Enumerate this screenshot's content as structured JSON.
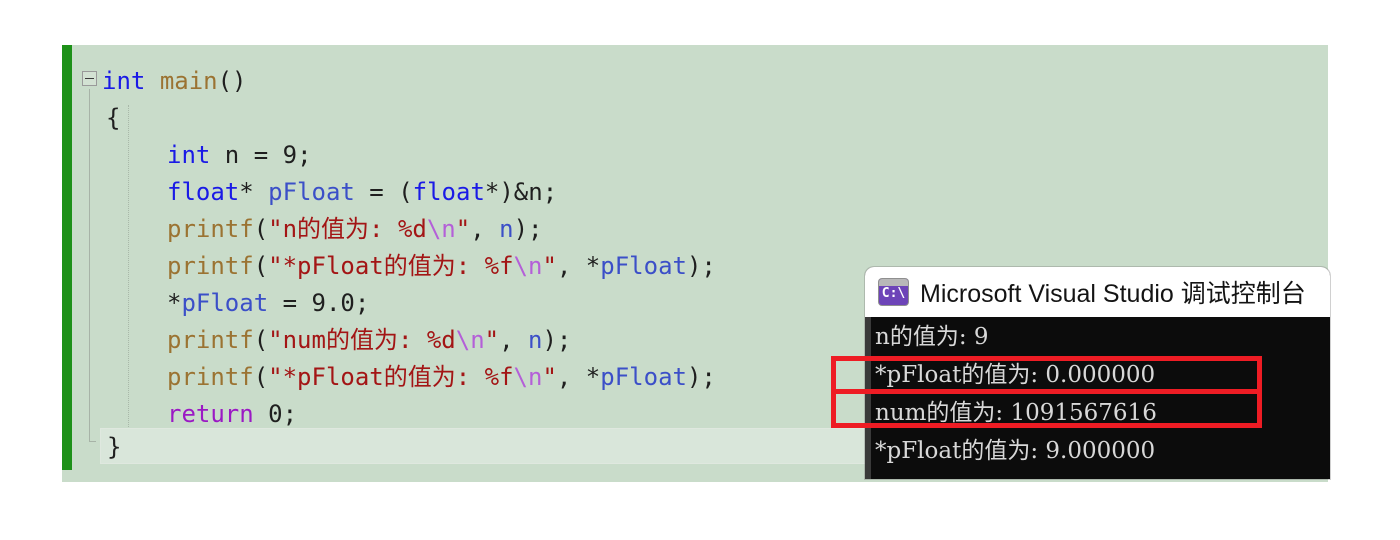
{
  "editor": {
    "name": "visual-studio-code-editor",
    "background_color": "#c9dcca",
    "change_bar_color": "#1e9119",
    "collapse_glyph": "−",
    "code_lines": [
      {
        "indent": 0,
        "tokens": [
          {
            "cls": "kw",
            "t": "int"
          },
          {
            "cls": "plain",
            "t": " "
          },
          {
            "cls": "fn",
            "t": "main"
          },
          {
            "cls": "plain",
            "t": "()"
          }
        ]
      },
      {
        "indent": 1,
        "tokens": [
          {
            "cls": "plain",
            "t": "{"
          }
        ]
      },
      {
        "indent": 2,
        "tokens": [
          {
            "cls": "kw",
            "t": "int"
          },
          {
            "cls": "plain",
            "t": " n = "
          },
          {
            "cls": "num",
            "t": "9"
          },
          {
            "cls": "plain",
            "t": ";"
          }
        ]
      },
      {
        "indent": 2,
        "tokens": [
          {
            "cls": "kw",
            "t": "float"
          },
          {
            "cls": "plain",
            "t": "* "
          },
          {
            "cls": "var",
            "t": "pFloat"
          },
          {
            "cls": "plain",
            "t": " = ("
          },
          {
            "cls": "kw",
            "t": "float"
          },
          {
            "cls": "plain",
            "t": "*)&n;"
          }
        ]
      },
      {
        "indent": 2,
        "tokens": [
          {
            "cls": "fn",
            "t": "printf"
          },
          {
            "cls": "plain",
            "t": "("
          },
          {
            "cls": "str",
            "t": "\"n的值为: %d"
          },
          {
            "cls": "esc",
            "t": "\\n"
          },
          {
            "cls": "str",
            "t": "\""
          },
          {
            "cls": "plain",
            "t": ", "
          },
          {
            "cls": "var",
            "t": "n"
          },
          {
            "cls": "plain",
            "t": ");"
          }
        ]
      },
      {
        "indent": 2,
        "tokens": [
          {
            "cls": "fn",
            "t": "printf"
          },
          {
            "cls": "plain",
            "t": "("
          },
          {
            "cls": "str",
            "t": "\"*pFloat的值为: %f"
          },
          {
            "cls": "esc",
            "t": "\\n"
          },
          {
            "cls": "str",
            "t": "\""
          },
          {
            "cls": "plain",
            "t": ", *"
          },
          {
            "cls": "var",
            "t": "pFloat"
          },
          {
            "cls": "plain",
            "t": ");"
          }
        ]
      },
      {
        "indent": 2,
        "tokens": [
          {
            "cls": "plain",
            "t": "*"
          },
          {
            "cls": "var",
            "t": "pFloat"
          },
          {
            "cls": "plain",
            "t": " = "
          },
          {
            "cls": "num",
            "t": "9.0"
          },
          {
            "cls": "plain",
            "t": ";"
          }
        ]
      },
      {
        "indent": 2,
        "tokens": [
          {
            "cls": "fn",
            "t": "printf"
          },
          {
            "cls": "plain",
            "t": "("
          },
          {
            "cls": "str",
            "t": "\"num的值为: %d"
          },
          {
            "cls": "esc",
            "t": "\\n"
          },
          {
            "cls": "str",
            "t": "\""
          },
          {
            "cls": "plain",
            "t": ", "
          },
          {
            "cls": "var",
            "t": "n"
          },
          {
            "cls": "plain",
            "t": ");"
          }
        ]
      },
      {
        "indent": 2,
        "tokens": [
          {
            "cls": "fn",
            "t": "printf"
          },
          {
            "cls": "plain",
            "t": "("
          },
          {
            "cls": "str",
            "t": "\"*pFloat的值为: %f"
          },
          {
            "cls": "esc",
            "t": "\\n"
          },
          {
            "cls": "str",
            "t": "\""
          },
          {
            "cls": "plain",
            "t": ", *"
          },
          {
            "cls": "var",
            "t": "pFloat"
          },
          {
            "cls": "plain",
            "t": ");"
          }
        ]
      },
      {
        "indent": 2,
        "tokens": [
          {
            "cls": "kw2",
            "t": "return"
          },
          {
            "cls": "plain",
            "t": " "
          },
          {
            "cls": "num",
            "t": "0"
          },
          {
            "cls": "plain",
            "t": ";"
          }
        ]
      }
    ],
    "current_line_text": "}"
  },
  "console": {
    "title": "Microsoft Visual Studio 调试控制台",
    "icon_name": "command-prompt-icon",
    "icon_glyph": "C:\\",
    "icon_color": "#6d44b8",
    "background_color": "#0c0c0c",
    "text_color": "#d8d8d8",
    "output_lines": [
      "n的值为: 9",
      "*pFloat的值为: 0.000000",
      "num的值为: 1091567616",
      "*pFloat的值为: 9.000000"
    ]
  },
  "annotations": {
    "color": "#ee1c24",
    "rects": [
      {
        "name": "highlight-pfloat-zero-line",
        "target_line": "*pFloat的值为: 0.000000"
      },
      {
        "name": "highlight-num-value-line",
        "target_line": "num的值为: 1091567616"
      }
    ]
  }
}
